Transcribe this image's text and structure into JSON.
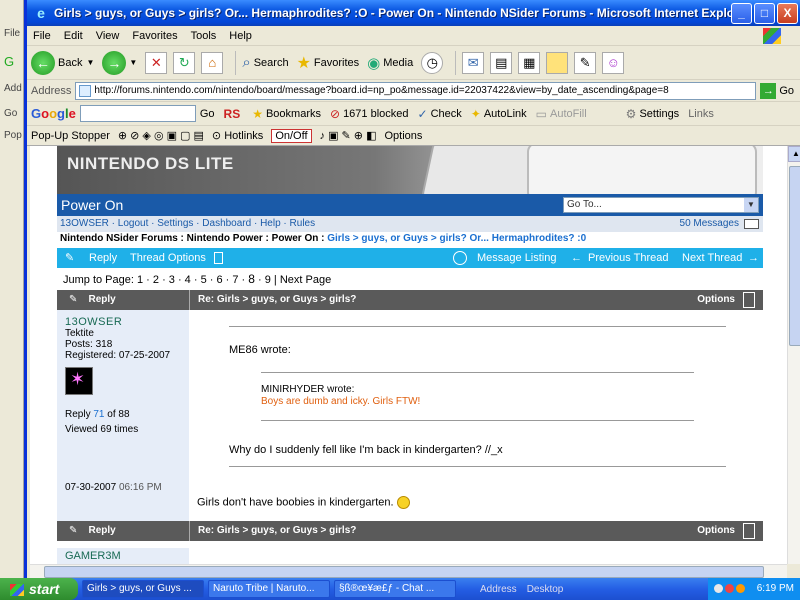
{
  "window": {
    "title": "Girls > guys, or Guys > girls? Or... Hermaphrodites? :O - Power On - Nintendo NSider Forums - Microsoft Internet Explorer",
    "min": "_",
    "max": "□",
    "close": "X"
  },
  "ghost": {
    "file": "File",
    "back": "G",
    "add": "Add",
    "go": "Go",
    "pop": "Pop"
  },
  "menu": [
    "File",
    "Edit",
    "View",
    "Favorites",
    "Tools",
    "Help"
  ],
  "toolbar": {
    "back": "Back",
    "search": "Search",
    "favorites": "Favorites",
    "media": "Media"
  },
  "address": {
    "label": "Address",
    "url": "http://forums.nintendo.com/nintendo/board/message?board.id=np_po&message.id=22037422&view=by_date_ascending&page=8",
    "go": "Go",
    "links": "Links"
  },
  "googlebar": {
    "go": "Go",
    "rs": "RS",
    "bookmarks": "Bookmarks",
    "blocked": "1671 blocked",
    "check": "Check",
    "autolink": "AutoLink",
    "autofill": "AutoFill",
    "settings": "Settings"
  },
  "popupbar": {
    "stopper": "Pop-Up Stopper",
    "hotlinks": "Hotlinks",
    "onoff": "On/Off",
    "options": "Options"
  },
  "forum": {
    "banner": "NINTENDO DS LITE",
    "section": "Power On",
    "goto": "Go To...",
    "userlinks": "13OWSER  ·  Logout  ·  Settings  ·  Dashboard  ·  Help  ·  Rules",
    "messages": "50 Messages",
    "crumbs_plain": "Nintendo NSider Forums : Nintendo Power : Power On : ",
    "crumbs_link": "Girls > guys, or Guys > girls? Or... Hermaphrodites? :0",
    "actions": {
      "reply": "Reply",
      "thread_options": "Thread Options",
      "listing": "Message Listing",
      "prev": "Previous Thread",
      "next": "Next Thread"
    },
    "jump": {
      "label": "Jump to Page:",
      "before": "1 · 2 · 3 · 4 · 5 · 6 · 7 ·",
      "current": "8",
      "after": "· 9  |  Next Page"
    },
    "post": {
      "reply": "Reply",
      "subject": "Re: Girls > guys, or Guys > girls?",
      "options": "Options",
      "username": "13OWSER",
      "rank": "Tektite",
      "posts": "Posts: 318",
      "registered": "Registered: 07-25-2007",
      "reply_prefix": "Reply",
      "reply_num": "71",
      "reply_suffix": "of 88",
      "viewed": "Viewed 69 times",
      "date": "07-30-2007",
      "time": "06:16 PM",
      "quote_author": "ME86 wrote:",
      "inner_author": "MINIRHYDER wrote:",
      "inner_text": "Boys are dumb and icky. Girls FTW!",
      "quote_text": "Why do I suddenly fell like I'm back in kindergarten? //_x",
      "text": "Girls don't have boobies in kindergarten."
    },
    "next_post": {
      "reply": "Reply",
      "subject": "Re: Girls > guys, or Guys > girls?",
      "options": "Options",
      "username": "GAMER3M"
    }
  },
  "taskbar": {
    "start": "start",
    "tasks": [
      "Girls > guys, or Guys ...",
      "Naruto Tribe | Naruto...",
      "§ß®œ¥æ£ƒ - Chat ..."
    ],
    "address": "Address",
    "desktop": "Desktop",
    "clock": "6:19 PM"
  }
}
